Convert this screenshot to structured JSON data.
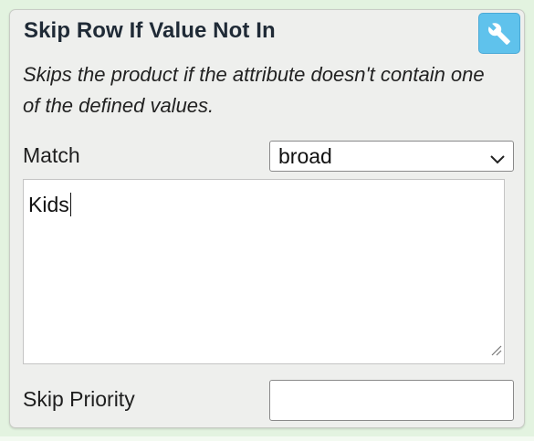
{
  "panel": {
    "title": "Skip Row If Value Not In",
    "description": "Skips the product if the attribute doesn't contain one of the defined values.",
    "settings_icon": "wrench-icon"
  },
  "match": {
    "label": "Match",
    "selected": "broad",
    "icon": "chevron-down-icon"
  },
  "values": {
    "text": "Kids"
  },
  "skip_priority": {
    "label": "Skip Priority",
    "value": ""
  },
  "colors": {
    "accent": "#5fc2ec",
    "panel_bg": "#eeefed",
    "page_bg": "#e3f3e0"
  }
}
